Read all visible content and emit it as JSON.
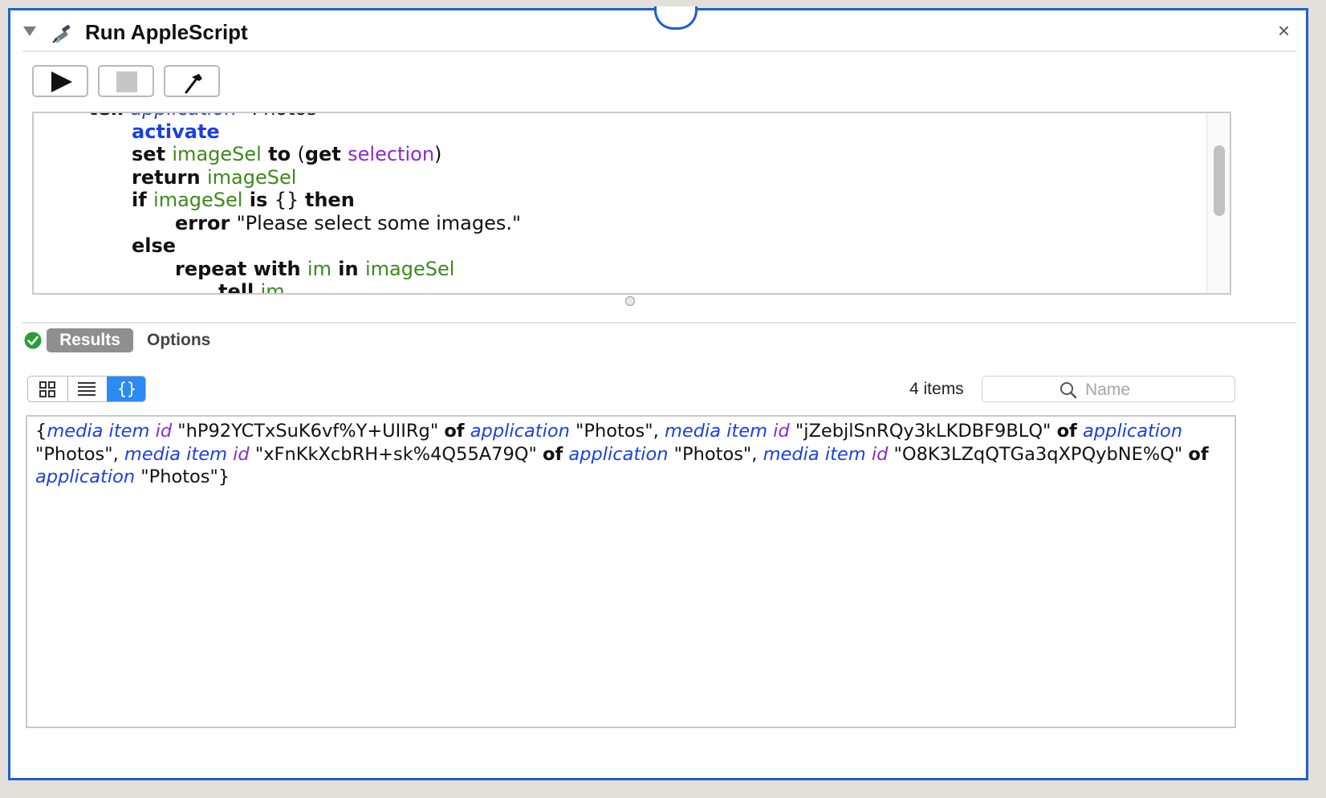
{
  "action": {
    "title": "Run AppleScript",
    "close_glyph": "×"
  },
  "toolbar": {
    "run_icon": "play-icon",
    "stop_icon": "stop-icon",
    "compile_icon": "hammer-icon"
  },
  "script_lines": [
    {
      "indent": 2,
      "tokens": [
        {
          "t": "tell ",
          "c": "kw"
        },
        {
          "t": "application",
          "c": "app"
        },
        {
          "t": " \"Photos\"",
          "c": "str"
        }
      ]
    },
    {
      "indent": 3,
      "tokens": [
        {
          "t": "activate",
          "c": "kwb"
        }
      ]
    },
    {
      "indent": 3,
      "tokens": [
        {
          "t": "set ",
          "c": "kw"
        },
        {
          "t": "imageSel",
          "c": "var"
        },
        {
          "t": " to ",
          "c": "kw"
        },
        {
          "t": "(",
          "c": "str"
        },
        {
          "t": "get ",
          "c": "kw"
        },
        {
          "t": "selection",
          "c": "prop"
        },
        {
          "t": ")",
          "c": "str"
        }
      ]
    },
    {
      "indent": 3,
      "tokens": [
        {
          "t": "return ",
          "c": "kw"
        },
        {
          "t": "imageSel",
          "c": "var"
        }
      ]
    },
    {
      "indent": 3,
      "tokens": [
        {
          "t": "if ",
          "c": "kw"
        },
        {
          "t": "imageSel",
          "c": "var"
        },
        {
          "t": " is ",
          "c": "kw"
        },
        {
          "t": "{} ",
          "c": "str"
        },
        {
          "t": "then",
          "c": "kw"
        }
      ]
    },
    {
      "indent": 4,
      "tokens": [
        {
          "t": "error ",
          "c": "kw"
        },
        {
          "t": "\"Please select some images.\"",
          "c": "str"
        }
      ]
    },
    {
      "indent": 3,
      "tokens": [
        {
          "t": "else",
          "c": "kw"
        }
      ]
    },
    {
      "indent": 4,
      "tokens": [
        {
          "t": "repeat with ",
          "c": "kw"
        },
        {
          "t": "im",
          "c": "var"
        },
        {
          "t": " in ",
          "c": "kw"
        },
        {
          "t": "imageSel",
          "c": "var"
        }
      ]
    },
    {
      "indent": 5,
      "tokens": [
        {
          "t": "tell ",
          "c": "kw"
        },
        {
          "t": "im",
          "c": "var"
        }
      ]
    }
  ],
  "results": {
    "tab_results": "Results",
    "tab_options": "Options",
    "status_icon": "checkmark-circle-icon",
    "status_color": "#2a9d3a",
    "item_count": "4 items",
    "search_placeholder": "Name",
    "view_source_glyph": "{}",
    "output_tokens": [
      {
        "t": "{",
        "c": "plain"
      },
      {
        "t": "media item",
        "c": "cls"
      },
      {
        "t": " ",
        "c": "plain"
      },
      {
        "t": "id",
        "c": "prop"
      },
      {
        "t": " \"hP92YCTxSuK6vf%Y+UIIRg\" ",
        "c": "plain"
      },
      {
        "t": "of",
        "c": "of"
      },
      {
        "t": " ",
        "c": "plain"
      },
      {
        "t": "application",
        "c": "cls"
      },
      {
        "t": " \"Photos\", ",
        "c": "plain"
      },
      {
        "t": "media item",
        "c": "cls"
      },
      {
        "t": " ",
        "c": "plain"
      },
      {
        "t": "id",
        "c": "prop"
      },
      {
        "t": " \"jZebjlSnRQy3kLKDBF9BLQ\" ",
        "c": "plain"
      },
      {
        "t": "of",
        "c": "of"
      },
      {
        "t": " ",
        "c": "plain"
      },
      {
        "t": "application",
        "c": "cls"
      },
      {
        "t": " \"Photos\", ",
        "c": "plain"
      },
      {
        "t": "media item",
        "c": "cls"
      },
      {
        "t": " ",
        "c": "plain"
      },
      {
        "t": "id",
        "c": "prop"
      },
      {
        "t": " \"xFnKkXcbRH+sk%4Q55A79Q\" ",
        "c": "plain"
      },
      {
        "t": "of",
        "c": "of"
      },
      {
        "t": " ",
        "c": "plain"
      },
      {
        "t": "application",
        "c": "cls"
      },
      {
        "t": " \"Photos\", ",
        "c": "plain"
      },
      {
        "t": "media item",
        "c": "cls"
      },
      {
        "t": " ",
        "c": "plain"
      },
      {
        "t": "id",
        "c": "prop"
      },
      {
        "t": " \"O8K3LZqQTGa3qXPQybNE%Q\" ",
        "c": "plain"
      },
      {
        "t": "of",
        "c": "of"
      },
      {
        "t": " ",
        "c": "plain"
      },
      {
        "t": "application",
        "c": "cls"
      },
      {
        "t": " \"Photos\"}",
        "c": "plain"
      }
    ]
  },
  "colors": {
    "window_border": "#1f5fd0",
    "keyword_blue": "#1a3fe6",
    "variable_green": "#3c8a1c",
    "property_purple": "#8a2ad0",
    "selected_segment": "#2b8bf3"
  }
}
